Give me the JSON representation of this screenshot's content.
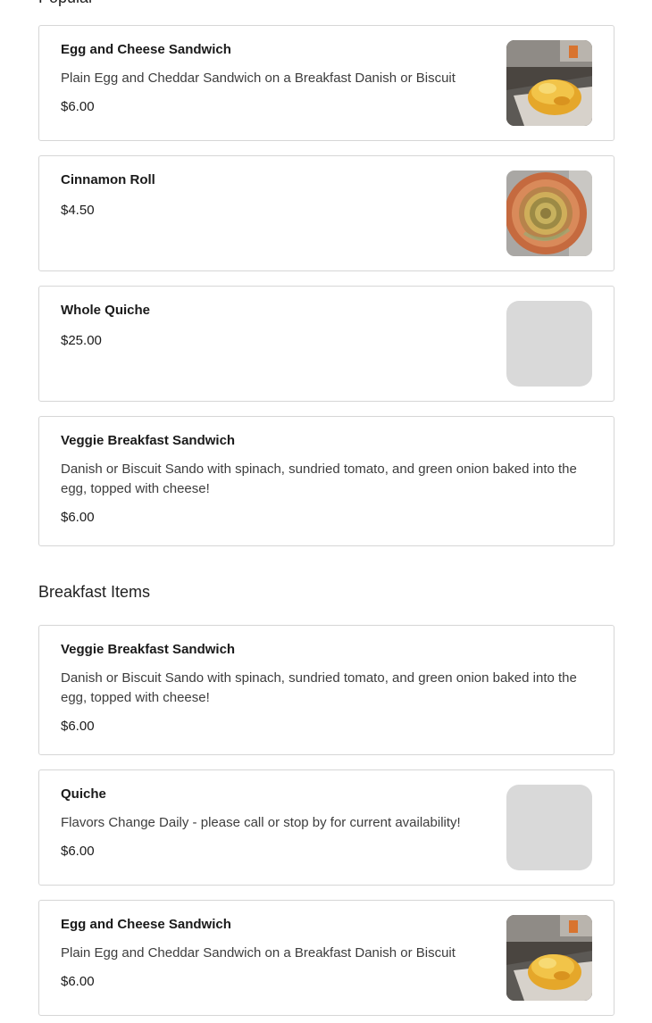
{
  "sections": [
    {
      "items": [
        {
          "name": "Egg and Cheese Sandwich",
          "description": "Plain Egg and Cheddar Sandwich on a Breakfast Danish or Biscuit",
          "price": "$6.00",
          "image": "egg-sandwich-photo"
        },
        {
          "name": "Cinnamon Roll",
          "price": "$4.50",
          "image": "cinnamon-roll-photo"
        },
        {
          "name": "Whole Quiche",
          "price": "$25.00",
          "image": "placeholder"
        },
        {
          "name": "Veggie Breakfast Sandwich",
          "description": "Danish or Biscuit Sando with spinach, sundried tomato, and green onion baked into the egg, topped with cheese!",
          "price": "$6.00"
        }
      ]
    },
    {
      "title": "Breakfast Items",
      "items": [
        {
          "name": "Veggie Breakfast Sandwich",
          "description": "Danish or Biscuit Sando with spinach, sundried tomato, and green onion baked into the egg, topped with cheese!",
          "price": "$6.00"
        },
        {
          "name": "Quiche",
          "description": "Flavors Change Daily - please call or stop by for current availability!",
          "price": "$6.00",
          "image": "placeholder"
        },
        {
          "name": "Egg and Cheese Sandwich",
          "description": "Plain Egg and Cheddar Sandwich on a Breakfast Danish or Biscuit",
          "price": "$6.00",
          "image": "egg-sandwich-photo"
        }
      ]
    }
  ],
  "colors": {
    "card_border": "#d6d6d6",
    "placeholder": "#d9d9d9",
    "text_primary": "#1a1a1a",
    "text_secondary": "#3d3d3d"
  }
}
